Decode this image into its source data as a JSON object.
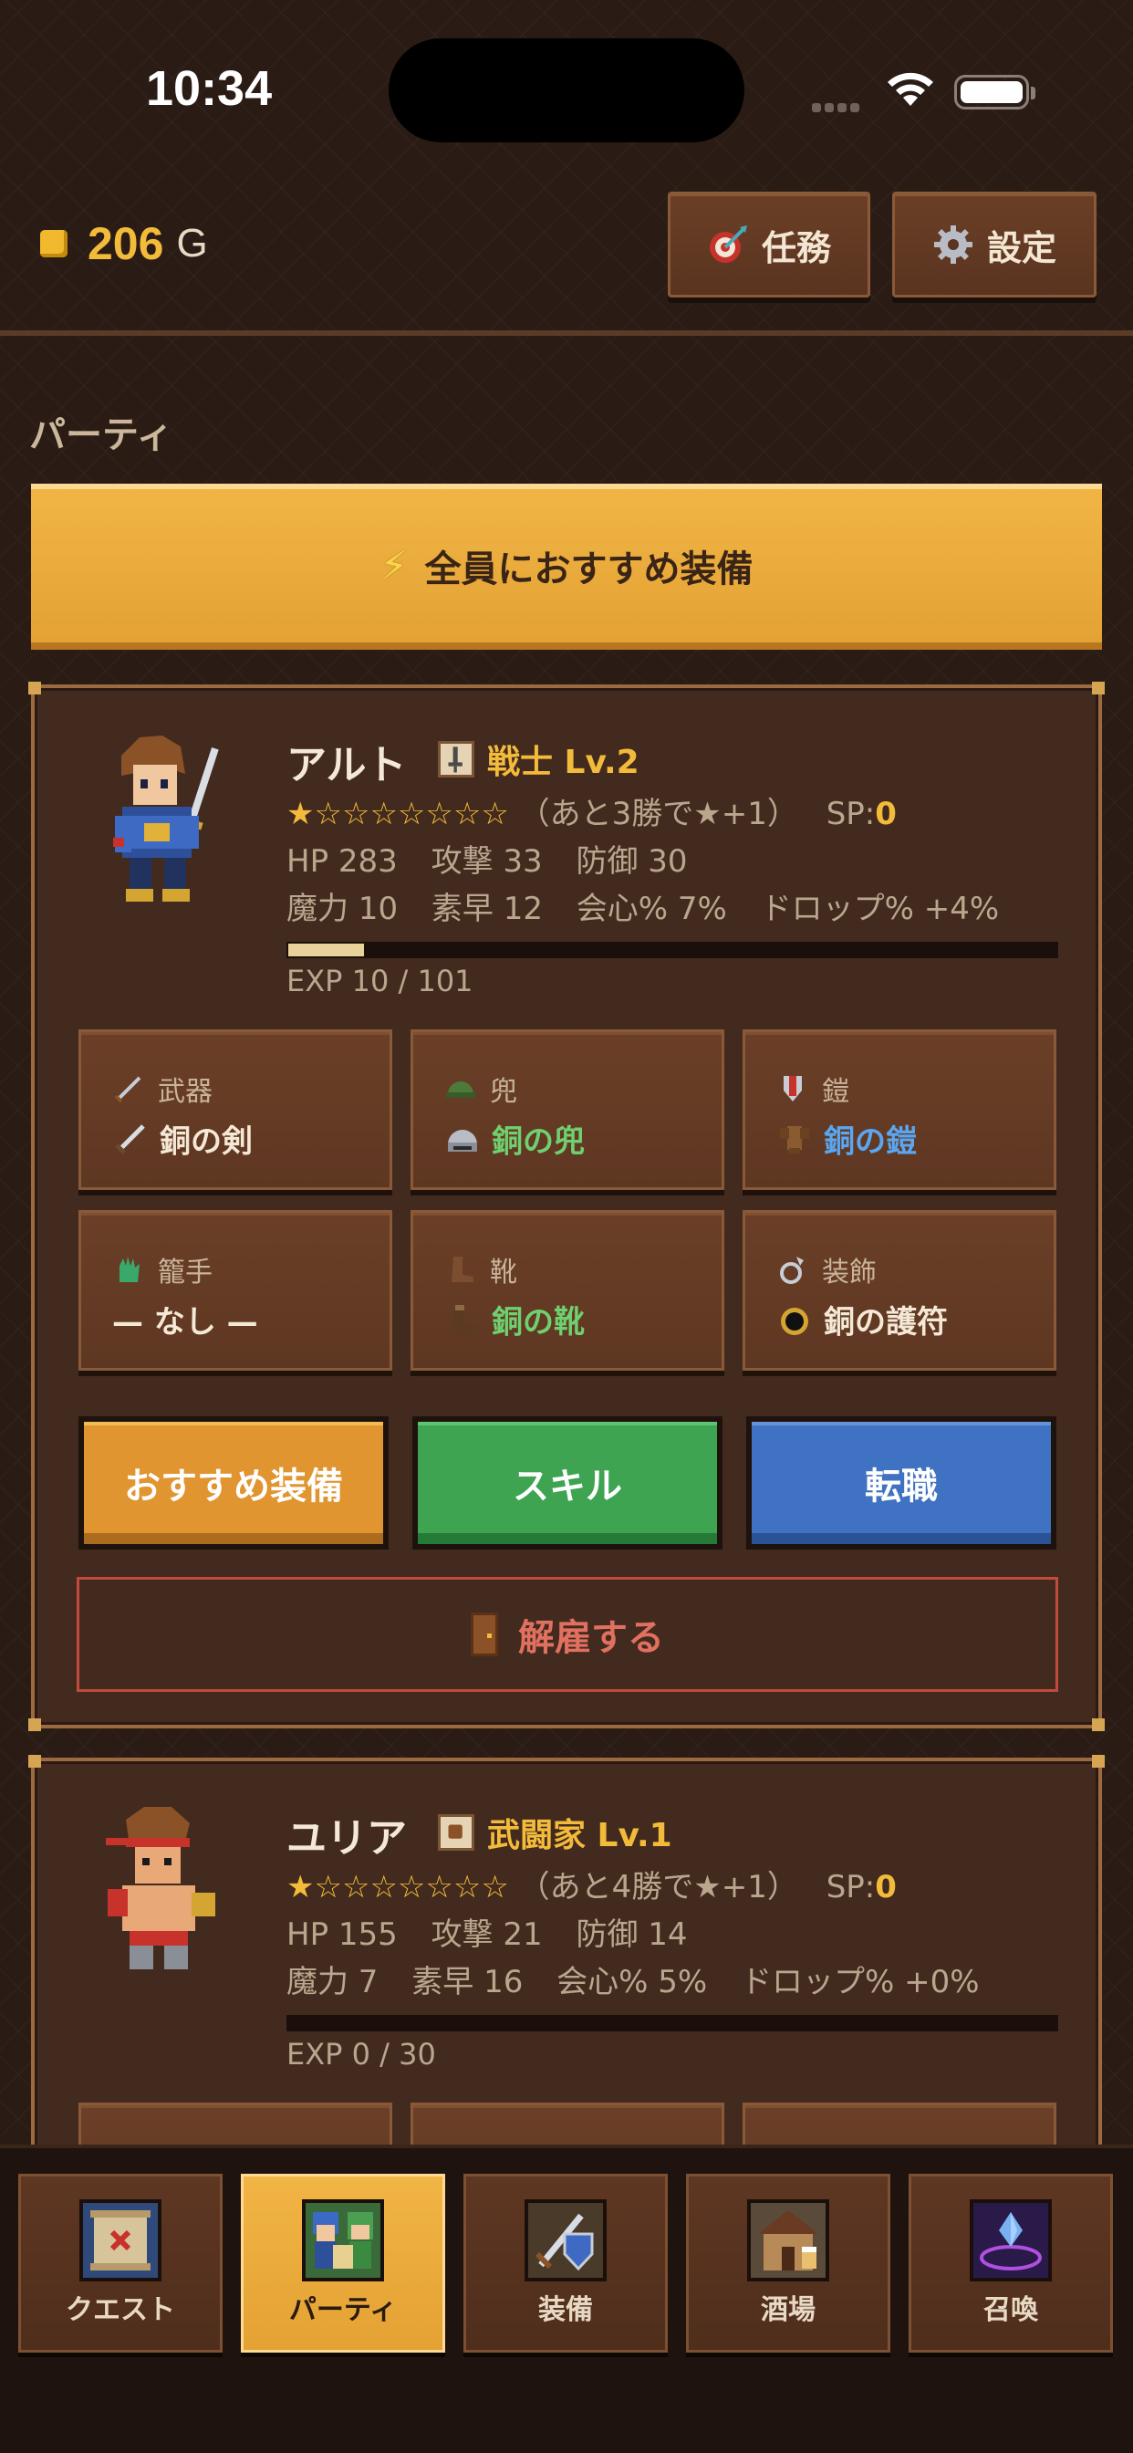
{
  "status_bar": {
    "time": "10:34"
  },
  "header": {
    "gold_amount": "206",
    "gold_unit": "G",
    "tasks_label": "任務",
    "settings_label": "設定"
  },
  "section_title": "パーティ",
  "recommend_all_label": "全員におすすめ装備",
  "members": [
    {
      "name": "アルト",
      "job": "戦士 Lv.2",
      "stars": "★☆☆☆☆☆☆☆",
      "stars_note": "（あと3勝で★+1）",
      "sp_label": "SP:",
      "sp_value": "0",
      "hp": "HP 283",
      "atk": "攻撃 33",
      "def": "防御 30",
      "mag": "魔力 10",
      "spd": "素早 12",
      "crit": "会心% 7%",
      "drop": "ドロップ% +4%",
      "exp_text": "EXP 10 / 101",
      "exp_fraction": 0.099,
      "equipment": [
        {
          "slot": "武器",
          "item": "銅の剣",
          "color": "#f4e8d6"
        },
        {
          "slot": "兜",
          "item": "銅の兜",
          "color": "#6fd070"
        },
        {
          "slot": "鎧",
          "item": "銅の鎧",
          "color": "#5aa6f0"
        },
        {
          "slot": "籠手",
          "item": "— なし —",
          "color": "#f4e8d6"
        },
        {
          "slot": "靴",
          "item": "銅の靴",
          "color": "#6fd070"
        },
        {
          "slot": "装飾",
          "item": "銅の護符",
          "color": "#f4e8d6"
        }
      ],
      "actions": {
        "recommend": "おすすめ装備",
        "skill": "スキル",
        "job_change": "転職",
        "dismiss": "解雇する"
      }
    },
    {
      "name": "ユリア",
      "job": "武闘家 Lv.1",
      "stars": "★☆☆☆☆☆☆☆",
      "stars_note": "（あと4勝で★+1）",
      "sp_label": "SP:",
      "sp_value": "0",
      "hp": "HP 155",
      "atk": "攻撃 21",
      "def": "防御 14",
      "mag": "魔力 7",
      "spd": "素早 16",
      "crit": "会心% 5%",
      "drop": "ドロップ% +0%",
      "exp_text": "EXP 0 / 30",
      "exp_fraction": 0
    }
  ],
  "tabs": [
    {
      "label": "クエスト",
      "icon": "quest-map-icon"
    },
    {
      "label": "パーティ",
      "icon": "party-icon",
      "active": true
    },
    {
      "label": "装備",
      "icon": "equipment-icon"
    },
    {
      "label": "酒場",
      "icon": "tavern-icon"
    },
    {
      "label": "召喚",
      "icon": "summon-icon"
    }
  ]
}
